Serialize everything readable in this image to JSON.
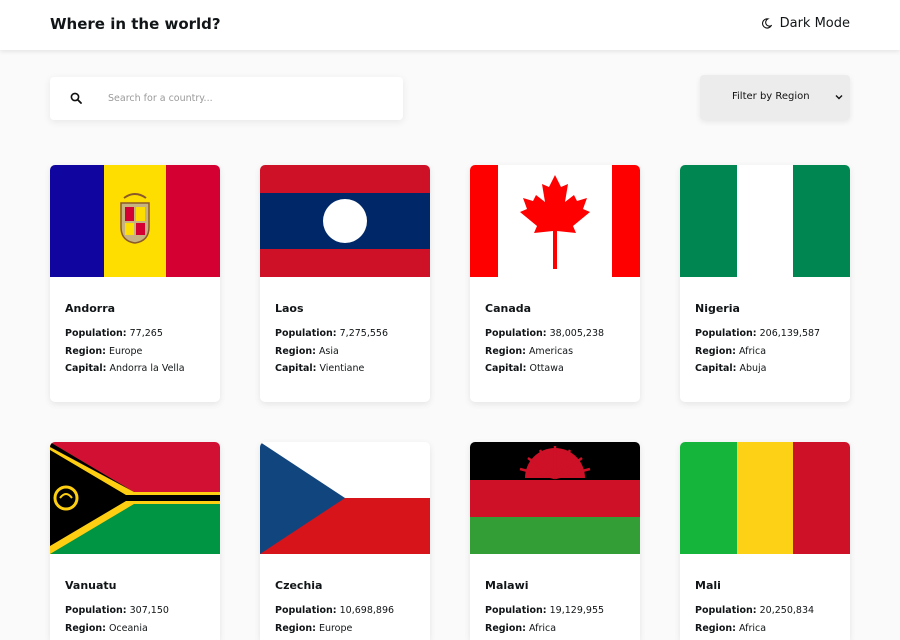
{
  "header": {
    "title": "Where in the world?",
    "mode_label": "Dark Mode"
  },
  "search": {
    "placeholder": "Search for a country...",
    "value": ""
  },
  "filter": {
    "label": "Filter by Region"
  },
  "labels": {
    "population": "Population:",
    "region": "Region:",
    "capital": "Capital:"
  },
  "countries": [
    {
      "name": "Andorra",
      "population": "77,265",
      "region": "Europe",
      "capital": "Andorra la Vella"
    },
    {
      "name": "Laos",
      "population": "7,275,556",
      "region": "Asia",
      "capital": "Vientiane"
    },
    {
      "name": "Canada",
      "population": "38,005,238",
      "region": "Americas",
      "capital": "Ottawa"
    },
    {
      "name": "Nigeria",
      "population": "206,139,587",
      "region": "Africa",
      "capital": "Abuja"
    },
    {
      "name": "Vanuatu",
      "population": "307,150",
      "region": "Oceania",
      "capital": ""
    },
    {
      "name": "Czechia",
      "population": "10,698,896",
      "region": "Europe",
      "capital": ""
    },
    {
      "name": "Malawi",
      "population": "19,129,955",
      "region": "Africa",
      "capital": ""
    },
    {
      "name": "Mali",
      "population": "20,250,834",
      "region": "Africa",
      "capital": ""
    }
  ],
  "icons": {
    "mode": "moon-icon",
    "search": "search-icon",
    "filter": "chevron-down-icon"
  }
}
